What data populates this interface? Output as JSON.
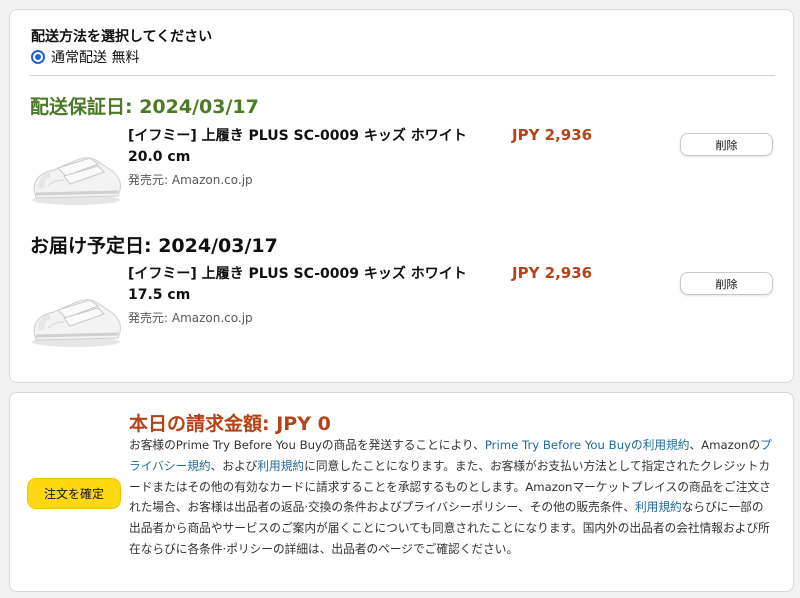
{
  "shipping": {
    "heading": "配送方法を選択してください",
    "option_label": "通常配送 無料"
  },
  "groups": [
    {
      "date_label": "配送保証日: 2024/03/17",
      "item": {
        "title_line1": "[イフミー] 上履き PLUS SC-0009 キッズ ホワイト",
        "title_line2": "20.0 cm",
        "seller": "発売元: Amazon.co.jp",
        "price": "JPY 2,936",
        "delete_label": "削除"
      }
    },
    {
      "date_label": "お届け予定日: 2024/03/17",
      "item": {
        "title_line1": "[イフミー] 上履き PLUS SC-0009 キッズ ホワイト",
        "title_line2": "17.5 cm",
        "seller": "発売元: Amazon.co.jp",
        "price": "JPY 2,936",
        "delete_label": "削除"
      }
    }
  ],
  "order": {
    "place_order_label": "注文を確定",
    "total_label": "本日の請求金額: JPY 0",
    "terms": {
      "t1": "お客様のPrime Try Before You Buyの商品を発送することにより、",
      "link_prime_terms": "Prime Try Before You Buyの利用規約",
      "t2": "、Amazonの",
      "link_privacy": "プライバシー規約",
      "t3": "、および",
      "link_terms_of_use": "利用規約",
      "t4": "に同意したことになります。また、お客様がお支払い方法として指定されたクレジットカードまたはその他の有効なカードに請求することを承認するものとします。Amazonマーケットプレイスの商品をご注文された場合、お客様は出品者の返品·交換の条件およびプライバシーポリシー、その他の販売条件、",
      "link_terms_of_use_2": "利用規約",
      "t5": "ならびに一部の出品者から商品やサービスのご案内が届くことについても同意されたことになります。国内外の出品者の会社情報および所在ならびに各条件·ポリシーの詳細は、出品者のページでご確認ください。"
    }
  },
  "colors": {
    "guarantee_date": "#4c7a26",
    "price": "#b5431a",
    "link": "#1e6b9b",
    "place_order_button": "#ffd814",
    "radio": "#2162d8"
  },
  "icons": {
    "product_image": "white-kids-shoe",
    "radio": "radio-selected"
  }
}
